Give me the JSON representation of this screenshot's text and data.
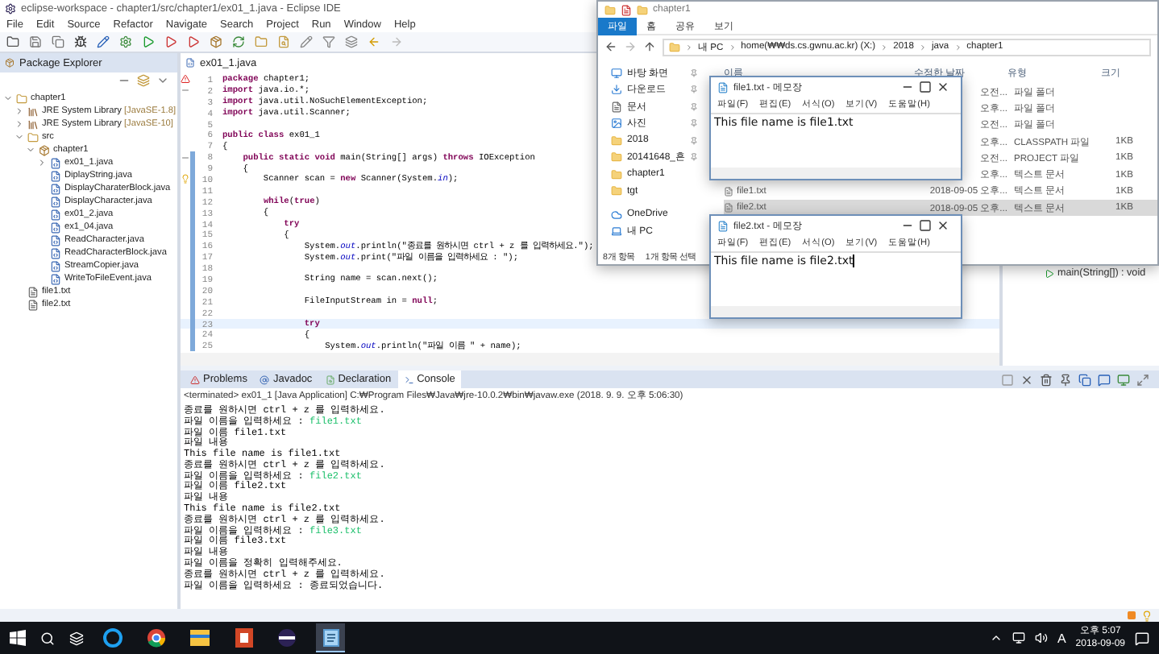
{
  "eclipse": {
    "title": "eclipse-workspace - chapter1/src/chapter1/ex01_1.java - Eclipse IDE",
    "menu": [
      "File",
      "Edit",
      "Source",
      "Refactor",
      "Navigate",
      "Search",
      "Project",
      "Run",
      "Window",
      "Help"
    ],
    "package_explorer": {
      "tab": "Package Explorer",
      "tree": [
        {
          "label": "chapter1",
          "kind": "project",
          "expanded": true,
          "children": [
            {
              "label": "JRE System Library",
              "decoration": "[JavaSE-1.8]",
              "kind": "library",
              "expanded": false
            },
            {
              "label": "JRE System Library",
              "decoration": "[JavaSE-10]",
              "kind": "library",
              "expanded": false
            },
            {
              "label": "src",
              "kind": "source",
              "expanded": true,
              "children": [
                {
                  "label": "chapter1",
                  "kind": "package",
                  "expanded": true,
                  "children": [
                    {
                      "label": "ex01_1.java",
                      "kind": "java",
                      "expanded": false
                    },
                    {
                      "label": "DiplayString.java",
                      "kind": "java"
                    },
                    {
                      "label": "DisplayCharaterBlock.java",
                      "kind": "java"
                    },
                    {
                      "label": "DisplayCharacter.java",
                      "kind": "java"
                    },
                    {
                      "label": "ex01_2.java",
                      "kind": "java"
                    },
                    {
                      "label": "ex1_04.java",
                      "kind": "java"
                    },
                    {
                      "label": "ReadCharacter.java",
                      "kind": "java"
                    },
                    {
                      "label": "ReadCharacterBlock.java",
                      "kind": "java"
                    },
                    {
                      "label": "StreamCopier.java",
                      "kind": "java"
                    },
                    {
                      "label": "WriteToFileEvent.java",
                      "kind": "java"
                    }
                  ]
                }
              ]
            },
            {
              "label": "file1.txt",
              "kind": "text"
            },
            {
              "label": "file2.txt",
              "kind": "text"
            }
          ]
        }
      ]
    },
    "editor": {
      "tab": "ex01_1.java",
      "lines": [
        {
          "num": "1",
          "text": "**package** chapter1;",
          "kind": "error",
          "in_range": false,
          "current": false
        },
        {
          "num": "2",
          "text": "**import** java.io.*;",
          "kind": "fold",
          "in_range": false,
          "current": false
        },
        {
          "num": "3",
          "text": "**import** java.util.NoSuchElementException;",
          "in_range": false,
          "current": false
        },
        {
          "num": "4",
          "text": "**import** java.util.Scanner;",
          "in_range": false,
          "current": false
        },
        {
          "num": "5",
          "in_range": false,
          "current": false
        },
        {
          "num": "6",
          "text": "**public class** ex01_1",
          "in_range": false,
          "current": false
        },
        {
          "num": "7",
          "text": "{",
          "in_range": false,
          "current": false
        },
        {
          "num": "8",
          "text": "    **public static void** main(String[] args) **throws** IOException",
          "kind": "fold",
          "in_range": true,
          "current": false
        },
        {
          "num": "9",
          "text": "    {",
          "in_range": true,
          "current": false
        },
        {
          "num": "10",
          "text": "        Scanner scan = **new** Scanner(System.*in*);",
          "kind": "warning",
          "in_range": true,
          "current": false
        },
        {
          "num": "11",
          "in_range": true,
          "current": false
        },
        {
          "num": "12",
          "text": "        **while**(**true**)",
          "in_range": true,
          "current": false
        },
        {
          "num": "13",
          "text": "        {",
          "in_range": true,
          "current": false
        },
        {
          "num": "14",
          "text": "            **try**",
          "in_range": true,
          "current": false
        },
        {
          "num": "15",
          "text": "            {",
          "in_range": true,
          "current": false
        },
        {
          "num": "16",
          "text": "                System.*out*.println(\"종료를 원하시면 ctrl + z 를 입력하세요.\");",
          "in_range": true,
          "current": false
        },
        {
          "num": "17",
          "text": "                System.*out*.print(\"파일 이름을 입력하세요 : \");",
          "in_range": true,
          "current": false
        },
        {
          "num": "18",
          "in_range": true,
          "current": false
        },
        {
          "num": "19",
          "text": "                String name = scan.next();",
          "in_range": true,
          "current": false
        },
        {
          "num": "20",
          "in_range": true,
          "current": false
        },
        {
          "num": "21",
          "text": "                FileInputStream in = **null**;",
          "in_range": true,
          "current": false
        },
        {
          "num": "22",
          "in_range": true,
          "current": false
        },
        {
          "num": "23",
          "text": "                **try**",
          "in_range": true,
          "current": true
        },
        {
          "num": "24",
          "text": "                {",
          "in_range": true,
          "current": false
        },
        {
          "num": "25",
          "text": "                    System.*out*.println(\"파일 이름 \" + name);",
          "in_range": true,
          "current": false
        }
      ]
    },
    "outline": {
      "item": "main(String[]) : void"
    },
    "bottom_tabs": [
      {
        "label": "Problems",
        "kind": "problems",
        "selected": false
      },
      {
        "label": "Javadoc",
        "kind": "javadoc",
        "selected": false
      },
      {
        "label": "Declaration",
        "kind": "declaration",
        "selected": false
      },
      {
        "label": "Console",
        "kind": "console",
        "selected": true
      }
    ],
    "console": {
      "header": "<terminated> ex01_1 [Java Application] C:₩Program Files₩Java₩jre-10.0.2₩bin₩javaw.exe (2018. 9. 9. 오후 5:06:30)",
      "lines": [
        {
          "text": "종료를 원하시면 ctrl + z 를 입력하세요."
        },
        {
          "text": "파일 이름을 입력하세요 : ",
          "input": "file1.txt"
        },
        {
          "text": "파일 이름 file1.txt"
        },
        {
          "text": "파일 내용"
        },
        {
          "text": "This file name is file1.txt"
        },
        {
          "text": "종료를 원하시면 ctrl + z 를 입력하세요."
        },
        {
          "text": "파일 이름을 입력하세요 : ",
          "input": "file2.txt"
        },
        {
          "text": "파일 이름 file2.txt"
        },
        {
          "text": "파일 내용"
        },
        {
          "text": "This file name is file2.txt"
        },
        {
          "text": "종료를 원하시면 ctrl + z 를 입력하세요."
        },
        {
          "text": "파일 이름을 입력하세요 : ",
          "input": "file3.txt"
        },
        {
          "text": "파일 이름 file3.txt"
        },
        {
          "text": "파일 내용"
        },
        {
          "text": "파일 이름을 정확히 입력해주세요."
        },
        {
          "text": "종료를 원하시면 ctrl + z 를 입력하세요."
        },
        {
          "text": "파일 이름을 입력하세요 : 종료되었습니다."
        }
      ]
    }
  },
  "file_explorer": {
    "title": "chapter1",
    "ribbon_tabs": [
      {
        "label": "파일",
        "selected": true
      },
      {
        "label": "홈",
        "selected": false
      },
      {
        "label": "공유",
        "selected": false
      },
      {
        "label": "보기",
        "selected": false
      }
    ],
    "path": [
      "내 PC",
      "home(₩₩ds.cs.gwnu.ac.kr) (X:)",
      "2018",
      "java",
      "chapter1"
    ],
    "nav": [
      {
        "label": "바탕 화면",
        "kind": "desktop",
        "pinned": true
      },
      {
        "label": "다운로드",
        "kind": "download",
        "pinned": true
      },
      {
        "label": "문서",
        "kind": "document",
        "pinned": true
      },
      {
        "label": "사진",
        "kind": "picture",
        "pinned": true
      },
      {
        "label": "2018",
        "kind": "folder",
        "pinned": true
      },
      {
        "label": "20141648_흔",
        "kind": "folder",
        "pinned": true
      },
      {
        "label": "chapter1",
        "kind": "folder",
        "pinned": false
      },
      {
        "label": "tgt",
        "kind": "folder",
        "pinned": false
      },
      {
        "label": "OneDrive",
        "kind": "cloud",
        "pinned": false
      },
      {
        "label": "내 PC",
        "kind": "pc",
        "pinned": false
      }
    ],
    "columns": [
      "이름",
      "수정한 날짜",
      "유형",
      "크기"
    ],
    "rows": [
      {
        "modified": "오전...",
        "type": "파일 폴더",
        "selected": false
      },
      {
        "modified": "오후...",
        "type": "파일 폴더",
        "selected": false
      },
      {
        "modified": "오전...",
        "type": "파일 폴더",
        "selected": false
      },
      {
        "modified": "오후...",
        "type": "CLASSPATH 파일",
        "size": "1KB",
        "selected": false
      },
      {
        "modified": "오전...",
        "type": "PROJECT 파일",
        "size": "1KB",
        "selected": false
      },
      {
        "modified": "오후...",
        "type": "텍스트 문서",
        "size": "1KB",
        "selected": false
      },
      {
        "name": "file1.txt",
        "modified": "2018-09-05 오후...",
        "type": "텍스트 문서",
        "size": "1KB",
        "selected": false
      },
      {
        "name": "file2.txt",
        "modified": "2018-09-05 오후...",
        "type": "텍스트 문서",
        "size": "1KB",
        "selected": true
      }
    ],
    "status": [
      "8개 항목",
      "1개 항목 선택"
    ]
  },
  "notepads": [
    {
      "title": "file1.txt - 메모장",
      "menu": [
        "파일(F)",
        "편집(E)",
        "서식(O)",
        "보기(V)",
        "도움말(H)"
      ],
      "text": "This file name is file1.txt",
      "caret": false
    },
    {
      "title": "file2.txt - 메모장",
      "menu": [
        "파일(F)",
        "편집(E)",
        "서식(O)",
        "보기(V)",
        "도움말(H)"
      ],
      "text": "This file name is file2.txt",
      "caret": true
    }
  ],
  "taskbar": {
    "apps": [
      {
        "kind": "browser_e",
        "active": false
      },
      {
        "kind": "browser_c",
        "active": false
      },
      {
        "kind": "explorer",
        "active": false
      },
      {
        "kind": "slides",
        "active": false
      },
      {
        "kind": "eclipse",
        "active": false
      },
      {
        "kind": "notepad",
        "active": true
      }
    ],
    "ime": "A",
    "time": "오후 5:07",
    "date": "2018-09-09"
  }
}
